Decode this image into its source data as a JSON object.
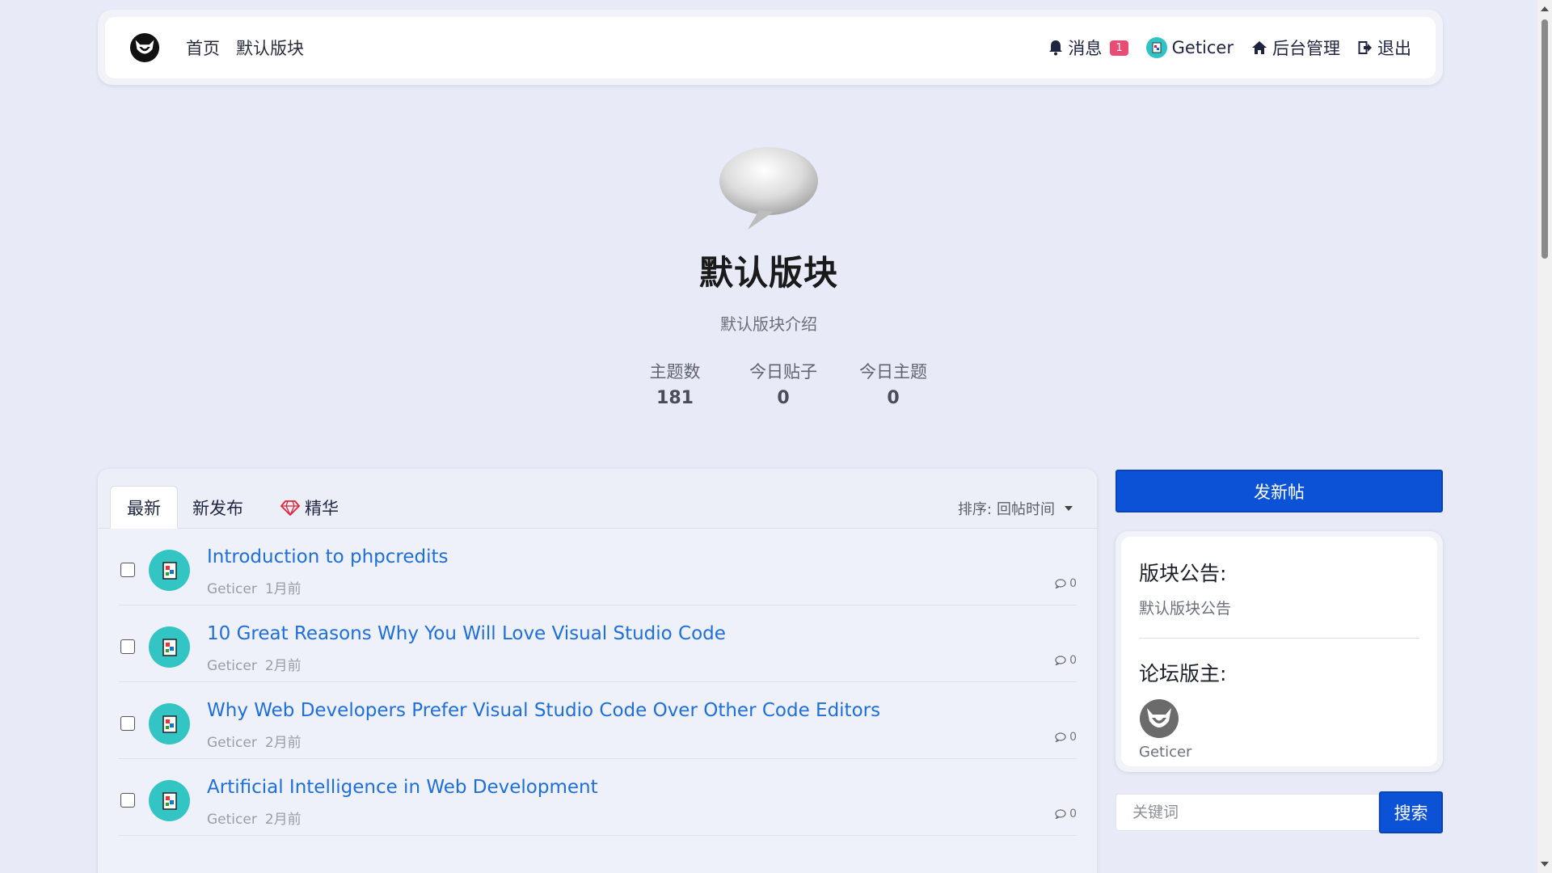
{
  "nav": {
    "links": [
      "首页",
      "默认版块"
    ],
    "messages_label": "消息",
    "messages_count": "1",
    "username": "Geticer",
    "admin_label": "后台管理",
    "logout_label": "退出"
  },
  "forum": {
    "title": "默认版块",
    "description": "默认版块介绍",
    "stats": [
      {
        "label": "主题数",
        "value": "181"
      },
      {
        "label": "今日贴子",
        "value": "0"
      },
      {
        "label": "今日主题",
        "value": "0"
      }
    ]
  },
  "tabs": {
    "latest": "最新",
    "new": "新发布",
    "featured": "精华"
  },
  "sort": {
    "label": "排序:",
    "value": "回帖时间"
  },
  "threads": [
    {
      "title": "Introduction to phpcredits",
      "author": "Geticer",
      "time": "1月前",
      "replies": "0"
    },
    {
      "title": "10 Great Reasons Why You Will Love Visual Studio Code",
      "author": "Geticer",
      "time": "2月前",
      "replies": "0"
    },
    {
      "title": "Why Web Developers Prefer Visual Studio Code Over Other Code Editors",
      "author": "Geticer",
      "time": "2月前",
      "replies": "0"
    },
    {
      "title": "Artificial Intelligence in Web Development",
      "author": "Geticer",
      "time": "2月前",
      "replies": "0"
    }
  ],
  "sidebar": {
    "new_post_label": "发新帖",
    "announcement_heading": "版块公告:",
    "announcement_text": "默认版块公告",
    "moderator_heading": "论坛版主:",
    "moderator_name": "Geticer"
  },
  "search": {
    "placeholder": "关键词",
    "button_label": "搜索"
  },
  "colors": {
    "accent": "#0c52d6",
    "link": "#1e6fd9",
    "badge": "#ea4d74",
    "avatar": "#33c4c4",
    "background": "#e8ebf7"
  }
}
